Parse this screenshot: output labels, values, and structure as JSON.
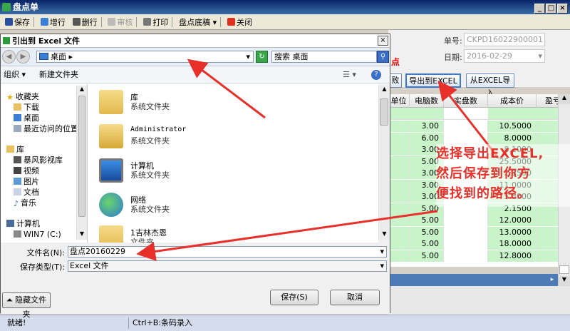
{
  "main": {
    "title": "盘点单",
    "win_buttons": [
      "_",
      "□",
      "×"
    ],
    "toolbar": {
      "save": "保存",
      "add_row": "增行",
      "del_row": "删行",
      "audit": "审核",
      "print": "打印",
      "base": "盘点底稿",
      "close": "关闭"
    },
    "form": {
      "number_label": "单号:",
      "number_value": "CKPD16022900001",
      "date_label": "日期:",
      "date_value": "2016-02-29",
      "red_fragment": "点",
      "btn_partial": "败",
      "export_excel": "导出到EXCEL",
      "import_excel": "从EXCEL导入"
    },
    "grid": {
      "headers": [
        "单位",
        "电脑数",
        "实盘数",
        "成本价",
        "盈亏"
      ],
      "rows": [
        {
          "unit": "",
          "pc": "3.00",
          "cost": "10.5000"
        },
        {
          "unit": "",
          "pc": "6.00",
          "cost": "8.0000"
        },
        {
          "unit": "",
          "pc": "3.00",
          "cost": "8.1000"
        },
        {
          "unit": "",
          "pc": "5.00",
          "cost": "25.5000"
        },
        {
          "unit": "",
          "pc": "3.00",
          "cost": "2.8500"
        },
        {
          "unit": "",
          "pc": "3.00",
          "cost": "11.0000"
        },
        {
          "unit": "",
          "pc": "3.00",
          "cost": "5.8000"
        },
        {
          "unit": "",
          "pc": "5.00",
          "cost": "2.1500"
        },
        {
          "unit": "",
          "pc": "5.00",
          "cost": "12.0000"
        },
        {
          "unit": "",
          "pc": "5.00",
          "cost": "13.0000"
        },
        {
          "unit": "",
          "pc": "5.00",
          "cost": "18.0000"
        },
        {
          "unit": "",
          "pc": "5.00",
          "cost": "12.8000"
        }
      ]
    },
    "status": {
      "ready": "就绪!",
      "hint": "Ctrl+B:条码录入"
    }
  },
  "dialog": {
    "title": "引出到 Excel 文件",
    "close": "×",
    "address": "桌面",
    "search_placeholder": "搜索 桌面",
    "organize": "组织 ▾",
    "new_folder": "新建文件夹",
    "tree": [
      {
        "label": "收藏夹",
        "icon": "star-icon"
      },
      {
        "label": "下载",
        "icon": "download-folder-icon"
      },
      {
        "label": "桌面",
        "icon": "desktop-icon"
      },
      {
        "label": "最近访问的位置",
        "icon": "recent-icon"
      },
      {
        "label": "库",
        "icon": "library-icon"
      },
      {
        "label": "暴风影视库",
        "icon": "video-library-icon"
      },
      {
        "label": "视频",
        "icon": "video-icon"
      },
      {
        "label": "图片",
        "icon": "picture-icon"
      },
      {
        "label": "文档",
        "icon": "document-icon"
      },
      {
        "label": "音乐",
        "icon": "music-icon"
      },
      {
        "label": "计算机",
        "icon": "computer-icon"
      },
      {
        "label": "WIN7 (C:)",
        "icon": "drive-icon"
      }
    ],
    "files": [
      {
        "name": "库",
        "desc": "系统文件夹",
        "icon": "library-folder-icon"
      },
      {
        "name": "Administrator",
        "desc": "系统文件夹",
        "icon": "user-folder-icon"
      },
      {
        "name": "计算机",
        "desc": "系统文件夹",
        "icon": "computer-icon"
      },
      {
        "name": "网络",
        "desc": "系统文件夹",
        "icon": "network-icon"
      },
      {
        "name": "1吉林杰恩",
        "desc": "文件夹",
        "icon": "folder-icon"
      }
    ],
    "filename_label": "文件名(N):",
    "filename_value": "盘点20160229",
    "filetype_label": "保存类型(T):",
    "filetype_value": "Excel 文件",
    "hide_folders": "隐藏文件夹",
    "save": "保存(S)",
    "cancel": "取消"
  },
  "annotation": {
    "text": "选择导出EXCEL,\n然后保存到你方\n便找到的路径。",
    "color": "#e8302a"
  }
}
